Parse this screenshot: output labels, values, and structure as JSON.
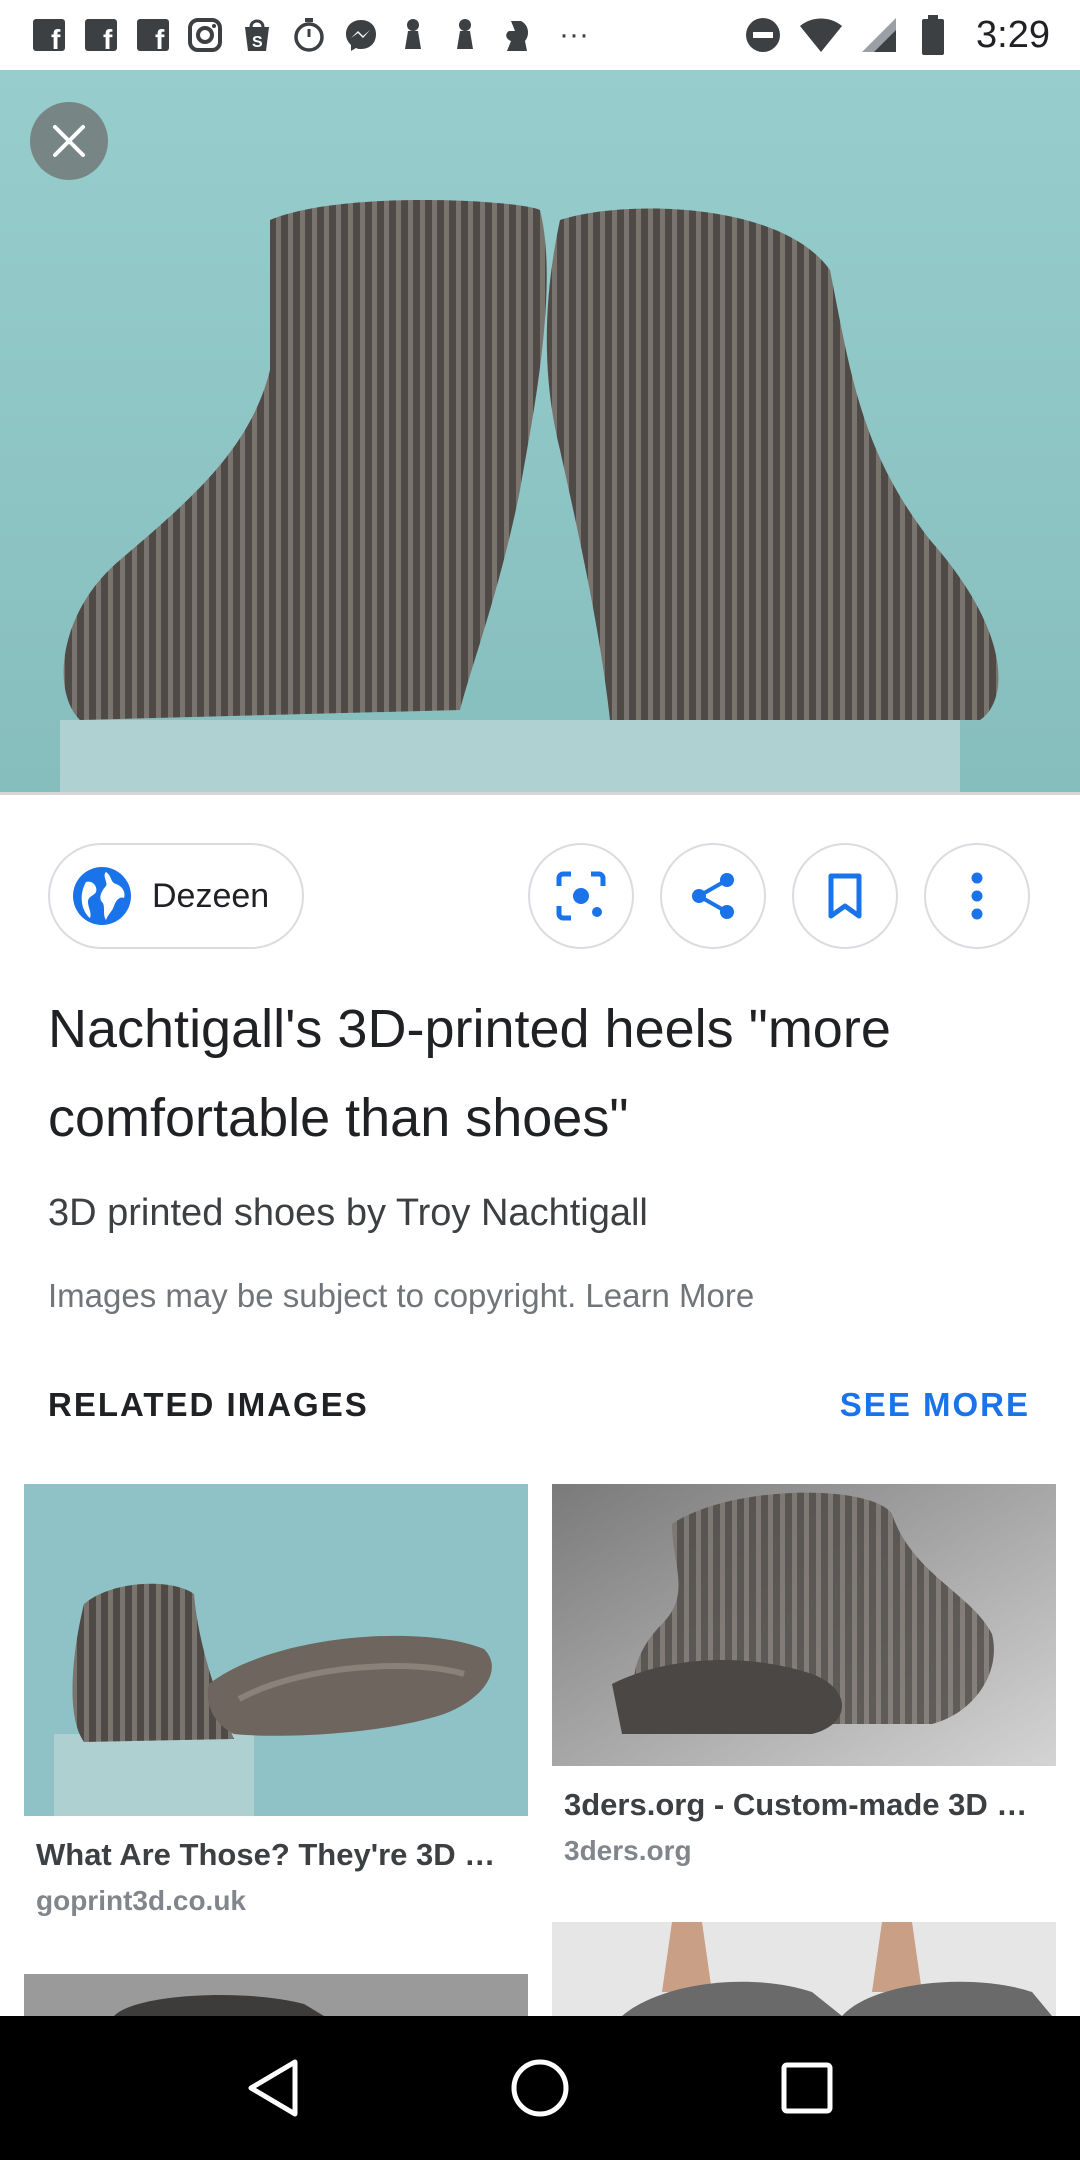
{
  "status_bar": {
    "time": "3:29",
    "left_icons": [
      "facebook-icon",
      "facebook-icon",
      "facebook-icon",
      "instagram-icon",
      "shopify-icon",
      "stopwatch-icon",
      "messenger-icon",
      "chess-pawn-icon",
      "chess-pawn-icon",
      "chess-knight-icon",
      "more-dots-icon"
    ],
    "right_icons": [
      "do-not-disturb-icon",
      "wifi-icon",
      "cell-signal-icon",
      "battery-icon"
    ],
    "more": "···"
  },
  "viewer": {
    "close_icon": "close-icon",
    "source": {
      "label": "Dezeen",
      "icon": "globe-icon"
    },
    "actions": [
      {
        "name": "lens-button",
        "icon": "lens-icon"
      },
      {
        "name": "share-button",
        "icon": "share-icon"
      },
      {
        "name": "save-button",
        "icon": "bookmark-icon"
      },
      {
        "name": "more-options-button",
        "icon": "more-vertical-icon"
      }
    ],
    "title": "Nachtigall's 3D-printed heels \"more comfortable than shoes\"",
    "subtitle": "3D printed shoes by Troy Nachtigall",
    "copyright": "Images may be subject to copyright. Learn More"
  },
  "related": {
    "heading": "RELATED IMAGES",
    "see_more": "SEE MORE",
    "items": [
      {
        "title": "What Are Those? They're 3D …",
        "source": "goprint3d.co.uk"
      },
      {
        "title": "3ders.org - Custom-made 3D …",
        "source": "3ders.org"
      }
    ]
  },
  "colors": {
    "accent": "#1a73e8",
    "hero_bg": "#8fc6c6",
    "shoe": "#5a5550"
  },
  "nav_bar": {
    "icons": [
      "back-icon",
      "home-icon",
      "recents-icon"
    ]
  }
}
